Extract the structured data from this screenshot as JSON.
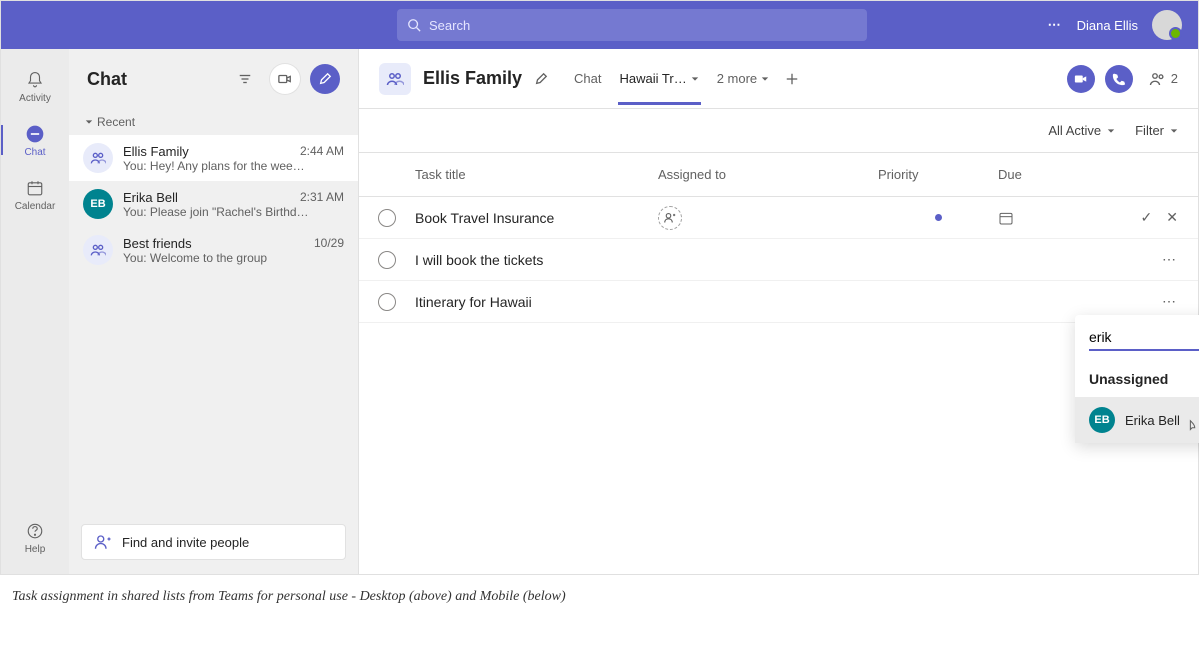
{
  "titlebar": {
    "search_placeholder": "Search",
    "user_name": "Diana Ellis"
  },
  "rail": {
    "activity": "Activity",
    "chat": "Chat",
    "calendar": "Calendar",
    "help": "Help"
  },
  "sidebar": {
    "title": "Chat",
    "recent": "Recent",
    "find_invite": "Find and invite people",
    "chats": [
      {
        "name": "Ellis Family",
        "time": "2:44 AM",
        "preview": "You: Hey! Any plans for the wee…",
        "initials": "",
        "group": true
      },
      {
        "name": "Erika Bell",
        "time": "2:31 AM",
        "preview": "You: Please join \"Rachel's Birthd…",
        "initials": "EB",
        "group": false
      },
      {
        "name": "Best friends",
        "time": "10/29",
        "preview": "You: Welcome to the group",
        "initials": "",
        "group": true
      }
    ]
  },
  "main": {
    "group_name": "Ellis Family",
    "tabs": {
      "chat": "Chat",
      "hawaii": "Hawaii Tr…",
      "more": "2 more"
    },
    "people_count": "2",
    "toolbar": {
      "all_active": "All Active",
      "filter": "Filter"
    },
    "columns": {
      "title": "Task title",
      "assigned": "Assigned to",
      "priority": "Priority",
      "due": "Due"
    },
    "tasks": [
      {
        "title": "Book Travel Insurance"
      },
      {
        "title": "I will book the tickets"
      },
      {
        "title": "Itinerary for Hawaii"
      }
    ]
  },
  "dropdown": {
    "search_value": "erik",
    "unassigned": "Unassigned",
    "options": [
      {
        "name": "Erika Bell",
        "initials": "EB"
      }
    ]
  },
  "caption": "Task assignment in shared lists from Teams for personal use - Desktop (above) and Mobile (below)"
}
